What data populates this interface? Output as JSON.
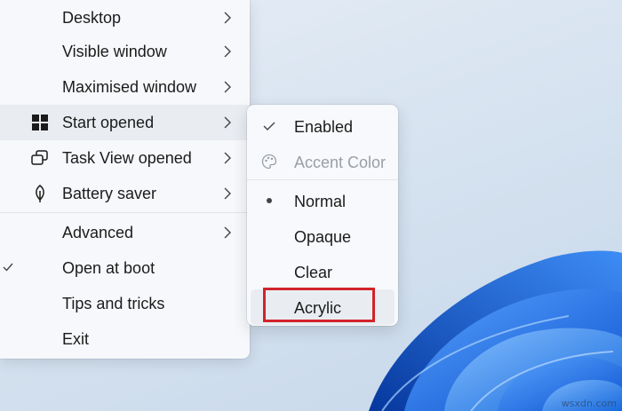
{
  "main_menu": {
    "items": [
      {
        "label": "Desktop",
        "has_submenu": true
      },
      {
        "label": "Visible window",
        "has_submenu": true
      },
      {
        "label": "Maximised window",
        "has_submenu": true
      },
      {
        "label": "Start opened",
        "has_submenu": true,
        "icon": "windows-logo-icon",
        "hovered": true
      },
      {
        "label": "Task View opened",
        "has_submenu": true,
        "icon": "task-view-icon"
      },
      {
        "label": "Battery saver",
        "has_submenu": true,
        "icon": "leaf-icon"
      },
      {
        "label": "Advanced",
        "has_submenu": true
      },
      {
        "label": "Open at boot",
        "checked": true
      },
      {
        "label": "Tips and tricks"
      },
      {
        "label": "Exit"
      }
    ]
  },
  "submenu": {
    "parent": "Start opened",
    "items": [
      {
        "label": "Enabled",
        "marker": "checkmark-icon",
        "enabled": true
      },
      {
        "label": "Accent Color",
        "marker": "palette-icon",
        "enabled": false
      },
      {
        "label": "Normal",
        "marker": "bullet-icon",
        "selected": true
      },
      {
        "label": "Opaque"
      },
      {
        "label": "Clear"
      },
      {
        "label": "Acrylic",
        "hovered": true,
        "annotated": true
      }
    ]
  },
  "annotation": {
    "color": "#d2232a",
    "target": "Acrylic"
  },
  "watermark": "wsxdn.com",
  "colors": {
    "menu_bg": "#f6f8fb",
    "hover_bg": "#e9edf2",
    "text": "#1b1b1b",
    "disabled_text": "#9aa0a6",
    "wallpaper_blue": "#1a6fe0"
  }
}
